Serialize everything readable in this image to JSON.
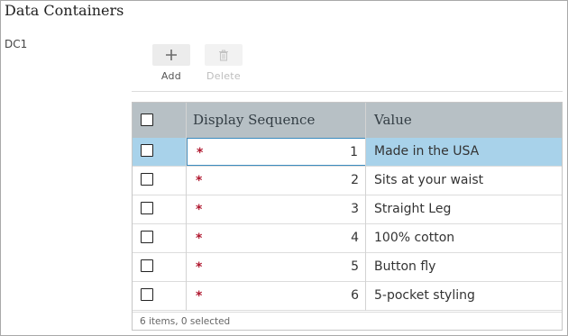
{
  "section_title": "Data Containers",
  "container_label": "DC1",
  "toolbar": {
    "add_label": "Add",
    "delete_label": "Delete"
  },
  "grid": {
    "columns": {
      "display_sequence": "Display Sequence",
      "value": "Value"
    },
    "rows": [
      {
        "sequence": "1",
        "value": "Made in the USA",
        "selected": true
      },
      {
        "sequence": "2",
        "value": "Sits at your waist",
        "selected": false
      },
      {
        "sequence": "3",
        "value": "Straight Leg",
        "selected": false
      },
      {
        "sequence": "4",
        "value": "100% cotton",
        "selected": false
      },
      {
        "sequence": "5",
        "value": "Button fly",
        "selected": false
      },
      {
        "sequence": "6",
        "value": "5-pocket styling",
        "selected": false
      }
    ],
    "required_marker": "*",
    "footer": "6 items, 0 selected"
  },
  "colors": {
    "header_bg": "#b7c0c5",
    "selected_row_bg": "#a8d2ea",
    "required_marker": "#b0182f"
  },
  "icons": {
    "add": "plus-icon",
    "delete": "trash-icon"
  }
}
